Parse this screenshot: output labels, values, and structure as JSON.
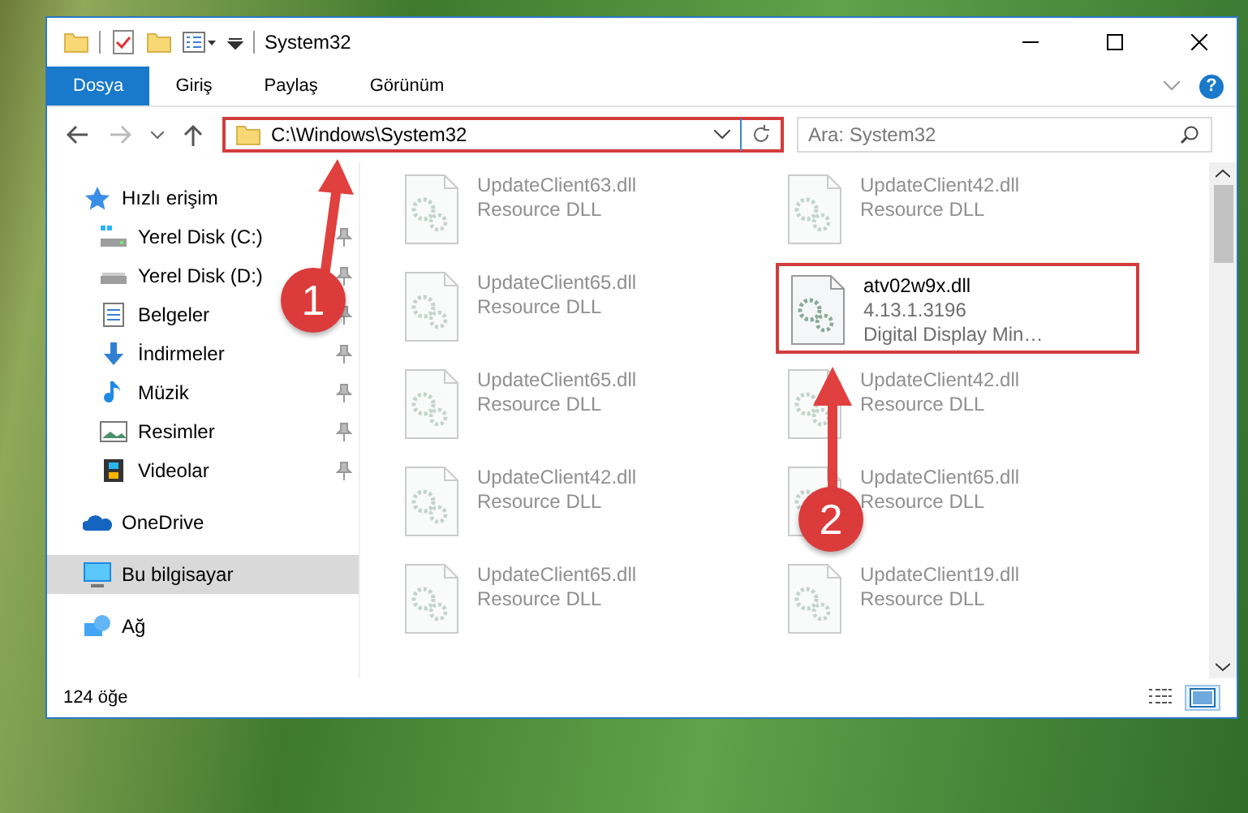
{
  "window": {
    "title": "System32"
  },
  "ribbon": {
    "tabs": [
      {
        "label": "Dosya",
        "selected": true
      },
      {
        "label": "Giriş",
        "selected": false
      },
      {
        "label": "Paylaş",
        "selected": false
      },
      {
        "label": "Görünüm",
        "selected": false
      }
    ],
    "help": "?"
  },
  "address_bar": {
    "path": "C:\\Windows\\System32",
    "highlighted": true
  },
  "search": {
    "placeholder": "Ara: System32"
  },
  "sidebar": {
    "items": [
      {
        "label": "Hızlı erişim",
        "kind": "star",
        "selected": false,
        "children": [
          {
            "label": "Yerel Disk (C:)",
            "kind": "sysdrive",
            "pinned": true
          },
          {
            "label": "Yerel Disk (D:)",
            "kind": "drive",
            "pinned": true
          },
          {
            "label": "Belgeler",
            "kind": "documents",
            "pinned": true
          },
          {
            "label": "İndirmeler",
            "kind": "downloads",
            "pinned": true
          },
          {
            "label": "Müzik",
            "kind": "music",
            "pinned": true
          },
          {
            "label": "Resimler",
            "kind": "pictures",
            "pinned": true
          },
          {
            "label": "Videolar",
            "kind": "videos",
            "pinned": true
          }
        ]
      },
      {
        "label": "OneDrive",
        "kind": "cloud",
        "selected": false
      },
      {
        "label": "Bu bilgisayar",
        "kind": "computer",
        "selected": true
      },
      {
        "label": "Ağ",
        "kind": "network",
        "selected": false
      }
    ]
  },
  "files": [
    {
      "name": "UpdateClient63.dll",
      "lines": [
        "Resource DLL"
      ],
      "blurred": true,
      "highlighted": false
    },
    {
      "name": "UpdateClient42.dll",
      "lines": [
        "Resource DLL"
      ],
      "blurred": true,
      "highlighted": false
    },
    {
      "name": "UpdateClient65.dll",
      "lines": [
        "Resource DLL"
      ],
      "blurred": true,
      "highlighted": false
    },
    {
      "name": "atv02w9x.dll",
      "lines": [
        "4.13.1.3196",
        "Digital Display Min…"
      ],
      "blurred": false,
      "highlighted": true
    },
    {
      "name": "UpdateClient65.dll",
      "lines": [
        "Resource DLL"
      ],
      "blurred": true,
      "highlighted": false
    },
    {
      "name": "UpdateClient42.dll",
      "lines": [
        "Resource DLL"
      ],
      "blurred": true,
      "highlighted": false
    },
    {
      "name": "UpdateClient42.dll",
      "lines": [
        "Resource DLL"
      ],
      "blurred": true,
      "highlighted": false
    },
    {
      "name": "UpdateClient65.dll",
      "lines": [
        "Resource DLL"
      ],
      "blurred": true,
      "highlighted": false
    },
    {
      "name": "UpdateClient65.dll",
      "lines": [
        "Resource DLL"
      ],
      "blurred": true,
      "highlighted": false
    },
    {
      "name": "UpdateClient19.dll",
      "lines": [
        "Resource DLL"
      ],
      "blurred": true,
      "highlighted": false
    }
  ],
  "status_bar": {
    "count": "124 öğe",
    "views": [
      {
        "kind": "details",
        "selected": false
      },
      {
        "kind": "large",
        "selected": true
      }
    ]
  },
  "annotations": [
    {
      "label": "1"
    },
    {
      "label": "2"
    }
  ]
}
